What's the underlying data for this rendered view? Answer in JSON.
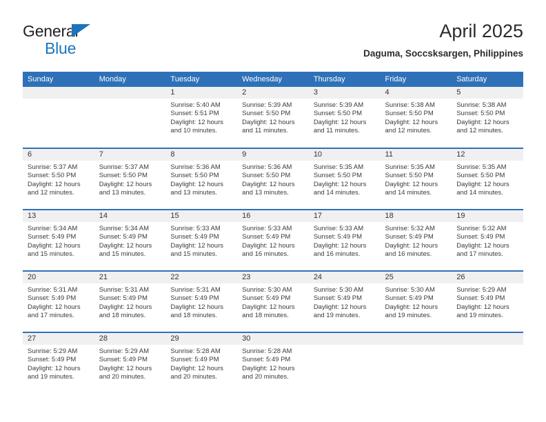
{
  "brand": {
    "line1": "General",
    "line2": "Blue",
    "flag_icon": "flag-triangle-icon",
    "accent_color": "#1b75bc"
  },
  "header": {
    "title": "April 2025",
    "subtitle": "Daguma, Soccsksargen, Philippines"
  },
  "colors": {
    "header_blue": "#2e71b8",
    "daynum_band": "#f0f0f0",
    "text": "#3a3a3a"
  },
  "weekdays": [
    "Sunday",
    "Monday",
    "Tuesday",
    "Wednesday",
    "Thursday",
    "Friday",
    "Saturday"
  ],
  "weeks": [
    [
      {
        "day": "",
        "blank": true
      },
      {
        "day": "",
        "blank": true
      },
      {
        "day": "1",
        "sunrise": "Sunrise: 5:40 AM",
        "sunset": "Sunset: 5:51 PM",
        "daylight1": "Daylight: 12 hours",
        "daylight2": "and 10 minutes."
      },
      {
        "day": "2",
        "sunrise": "Sunrise: 5:39 AM",
        "sunset": "Sunset: 5:50 PM",
        "daylight1": "Daylight: 12 hours",
        "daylight2": "and 11 minutes."
      },
      {
        "day": "3",
        "sunrise": "Sunrise: 5:39 AM",
        "sunset": "Sunset: 5:50 PM",
        "daylight1": "Daylight: 12 hours",
        "daylight2": "and 11 minutes."
      },
      {
        "day": "4",
        "sunrise": "Sunrise: 5:38 AM",
        "sunset": "Sunset: 5:50 PM",
        "daylight1": "Daylight: 12 hours",
        "daylight2": "and 12 minutes."
      },
      {
        "day": "5",
        "sunrise": "Sunrise: 5:38 AM",
        "sunset": "Sunset: 5:50 PM",
        "daylight1": "Daylight: 12 hours",
        "daylight2": "and 12 minutes."
      }
    ],
    [
      {
        "day": "6",
        "sunrise": "Sunrise: 5:37 AM",
        "sunset": "Sunset: 5:50 PM",
        "daylight1": "Daylight: 12 hours",
        "daylight2": "and 12 minutes."
      },
      {
        "day": "7",
        "sunrise": "Sunrise: 5:37 AM",
        "sunset": "Sunset: 5:50 PM",
        "daylight1": "Daylight: 12 hours",
        "daylight2": "and 13 minutes."
      },
      {
        "day": "8",
        "sunrise": "Sunrise: 5:36 AM",
        "sunset": "Sunset: 5:50 PM",
        "daylight1": "Daylight: 12 hours",
        "daylight2": "and 13 minutes."
      },
      {
        "day": "9",
        "sunrise": "Sunrise: 5:36 AM",
        "sunset": "Sunset: 5:50 PM",
        "daylight1": "Daylight: 12 hours",
        "daylight2": "and 13 minutes."
      },
      {
        "day": "10",
        "sunrise": "Sunrise: 5:35 AM",
        "sunset": "Sunset: 5:50 PM",
        "daylight1": "Daylight: 12 hours",
        "daylight2": "and 14 minutes."
      },
      {
        "day": "11",
        "sunrise": "Sunrise: 5:35 AM",
        "sunset": "Sunset: 5:50 PM",
        "daylight1": "Daylight: 12 hours",
        "daylight2": "and 14 minutes."
      },
      {
        "day": "12",
        "sunrise": "Sunrise: 5:35 AM",
        "sunset": "Sunset: 5:50 PM",
        "daylight1": "Daylight: 12 hours",
        "daylight2": "and 14 minutes."
      }
    ],
    [
      {
        "day": "13",
        "sunrise": "Sunrise: 5:34 AM",
        "sunset": "Sunset: 5:49 PM",
        "daylight1": "Daylight: 12 hours",
        "daylight2": "and 15 minutes."
      },
      {
        "day": "14",
        "sunrise": "Sunrise: 5:34 AM",
        "sunset": "Sunset: 5:49 PM",
        "daylight1": "Daylight: 12 hours",
        "daylight2": "and 15 minutes."
      },
      {
        "day": "15",
        "sunrise": "Sunrise: 5:33 AM",
        "sunset": "Sunset: 5:49 PM",
        "daylight1": "Daylight: 12 hours",
        "daylight2": "and 15 minutes."
      },
      {
        "day": "16",
        "sunrise": "Sunrise: 5:33 AM",
        "sunset": "Sunset: 5:49 PM",
        "daylight1": "Daylight: 12 hours",
        "daylight2": "and 16 minutes."
      },
      {
        "day": "17",
        "sunrise": "Sunrise: 5:33 AM",
        "sunset": "Sunset: 5:49 PM",
        "daylight1": "Daylight: 12 hours",
        "daylight2": "and 16 minutes."
      },
      {
        "day": "18",
        "sunrise": "Sunrise: 5:32 AM",
        "sunset": "Sunset: 5:49 PM",
        "daylight1": "Daylight: 12 hours",
        "daylight2": "and 16 minutes."
      },
      {
        "day": "19",
        "sunrise": "Sunrise: 5:32 AM",
        "sunset": "Sunset: 5:49 PM",
        "daylight1": "Daylight: 12 hours",
        "daylight2": "and 17 minutes."
      }
    ],
    [
      {
        "day": "20",
        "sunrise": "Sunrise: 5:31 AM",
        "sunset": "Sunset: 5:49 PM",
        "daylight1": "Daylight: 12 hours",
        "daylight2": "and 17 minutes."
      },
      {
        "day": "21",
        "sunrise": "Sunrise: 5:31 AM",
        "sunset": "Sunset: 5:49 PM",
        "daylight1": "Daylight: 12 hours",
        "daylight2": "and 18 minutes."
      },
      {
        "day": "22",
        "sunrise": "Sunrise: 5:31 AM",
        "sunset": "Sunset: 5:49 PM",
        "daylight1": "Daylight: 12 hours",
        "daylight2": "and 18 minutes."
      },
      {
        "day": "23",
        "sunrise": "Sunrise: 5:30 AM",
        "sunset": "Sunset: 5:49 PM",
        "daylight1": "Daylight: 12 hours",
        "daylight2": "and 18 minutes."
      },
      {
        "day": "24",
        "sunrise": "Sunrise: 5:30 AM",
        "sunset": "Sunset: 5:49 PM",
        "daylight1": "Daylight: 12 hours",
        "daylight2": "and 19 minutes."
      },
      {
        "day": "25",
        "sunrise": "Sunrise: 5:30 AM",
        "sunset": "Sunset: 5:49 PM",
        "daylight1": "Daylight: 12 hours",
        "daylight2": "and 19 minutes."
      },
      {
        "day": "26",
        "sunrise": "Sunrise: 5:29 AM",
        "sunset": "Sunset: 5:49 PM",
        "daylight1": "Daylight: 12 hours",
        "daylight2": "and 19 minutes."
      }
    ],
    [
      {
        "day": "27",
        "sunrise": "Sunrise: 5:29 AM",
        "sunset": "Sunset: 5:49 PM",
        "daylight1": "Daylight: 12 hours",
        "daylight2": "and 19 minutes."
      },
      {
        "day": "28",
        "sunrise": "Sunrise: 5:29 AM",
        "sunset": "Sunset: 5:49 PM",
        "daylight1": "Daylight: 12 hours",
        "daylight2": "and 20 minutes."
      },
      {
        "day": "29",
        "sunrise": "Sunrise: 5:28 AM",
        "sunset": "Sunset: 5:49 PM",
        "daylight1": "Daylight: 12 hours",
        "daylight2": "and 20 minutes."
      },
      {
        "day": "30",
        "sunrise": "Sunrise: 5:28 AM",
        "sunset": "Sunset: 5:49 PM",
        "daylight1": "Daylight: 12 hours",
        "daylight2": "and 20 minutes."
      },
      {
        "day": "",
        "blank": true
      },
      {
        "day": "",
        "blank": true
      },
      {
        "day": "",
        "blank": true
      }
    ]
  ]
}
